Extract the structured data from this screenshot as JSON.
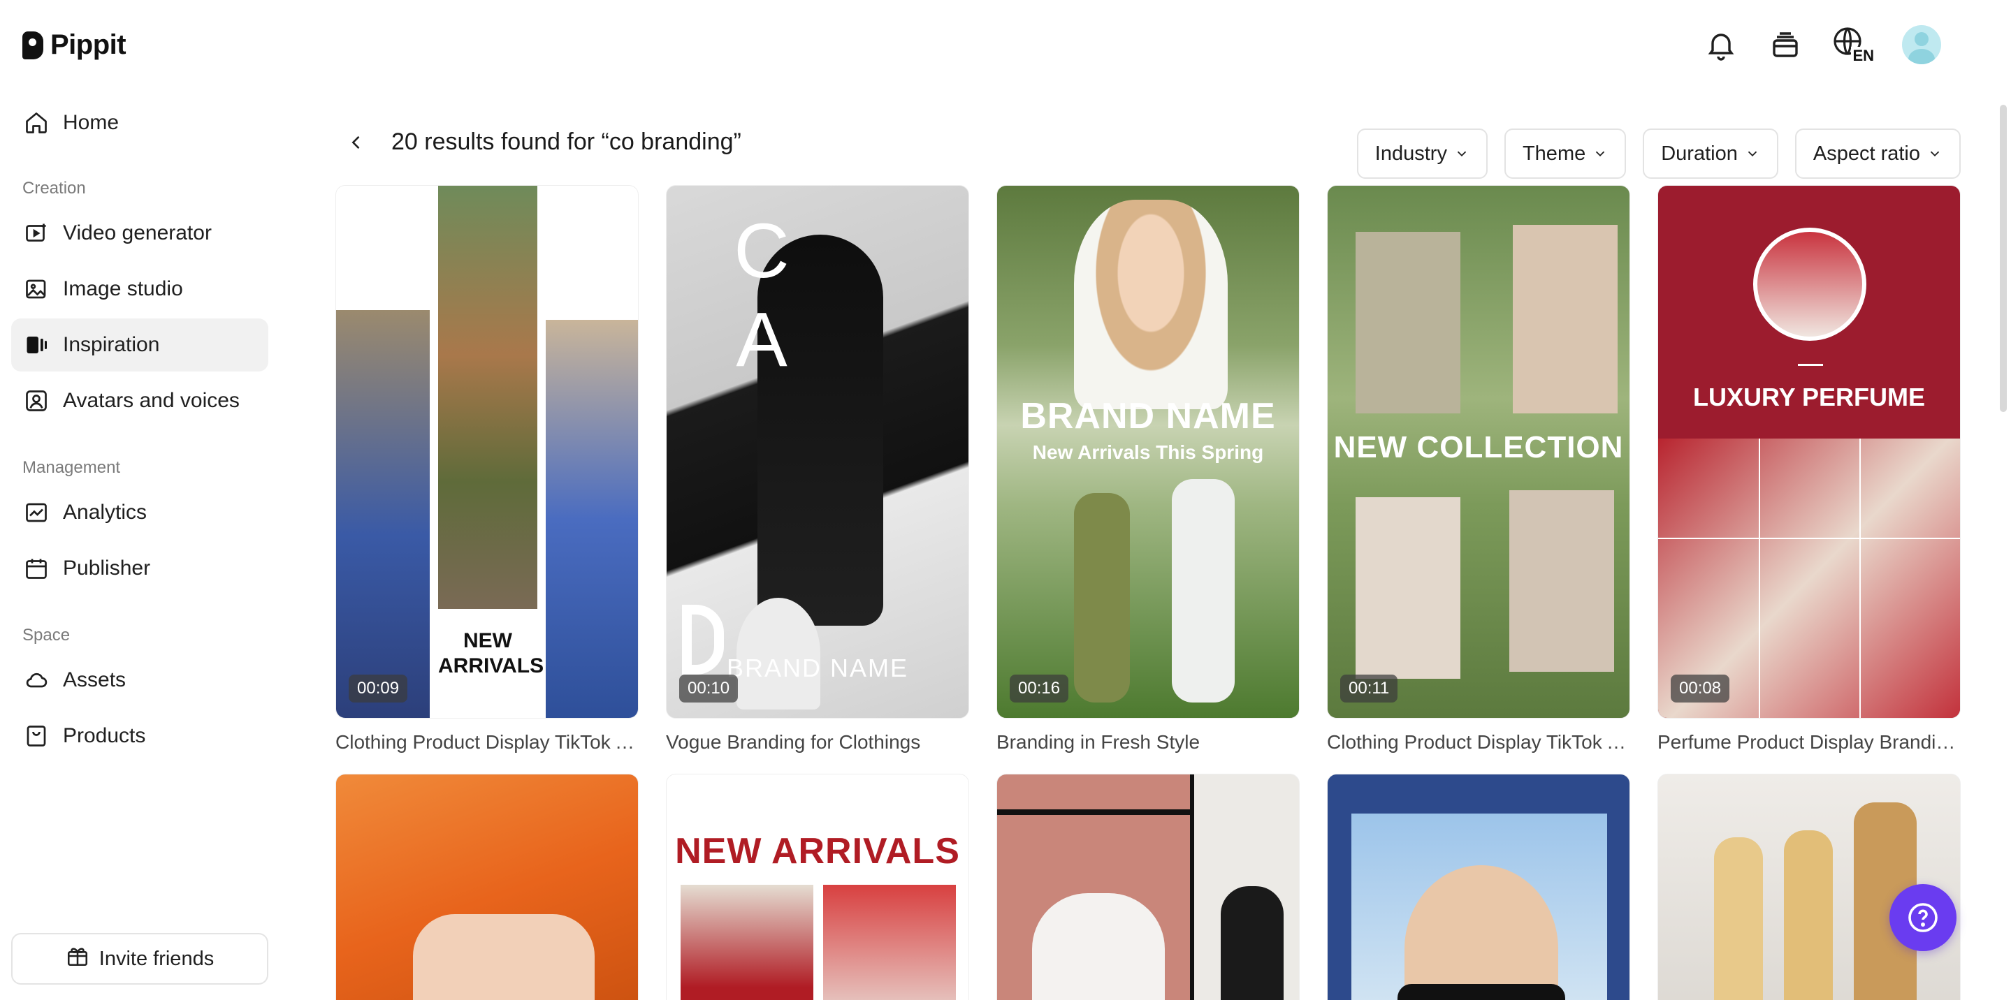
{
  "app": {
    "name": "Pippit"
  },
  "sidebar": {
    "home": "Home",
    "creation_label": "Creation",
    "creation_items": [
      "Video generator",
      "Image studio",
      "Inspiration",
      "Avatars and voices"
    ],
    "management_label": "Management",
    "management_items": [
      "Analytics",
      "Publisher"
    ],
    "space_label": "Space",
    "space_items": [
      "Assets",
      "Products"
    ],
    "invite": "Invite friends",
    "active_item": "Inspiration"
  },
  "topbar": {
    "language": "EN"
  },
  "results": {
    "title": "20 results found for “co branding”"
  },
  "filters": [
    "Industry",
    "Theme",
    "Duration",
    "Aspect ratio"
  ],
  "cards_row1": [
    {
      "duration": "00:09",
      "title": "Clothing Product Display TikTok Ad",
      "overlay": "NEW ARRIVALS"
    },
    {
      "duration": "00:10",
      "title": "Vogue Branding for Clothings",
      "overlay_letters": "C A",
      "overlay": "BRAND NAME"
    },
    {
      "duration": "00:16",
      "title": "Branding in Fresh Style",
      "overlay": "BRAND NAME",
      "overlay_sub": "New Arrivals This Spring"
    },
    {
      "duration": "00:11",
      "title": "Clothing Product Display TikTok Ad",
      "overlay": "NEW COLLECTION"
    },
    {
      "duration": "00:08",
      "title": "Perfume Product Display Branding Ad",
      "overlay": "LUXURY PERFUME"
    }
  ],
  "cards_row2": [
    {
      "overlay": ""
    },
    {
      "overlay": "NEW ARRIVALS"
    },
    {
      "overlay": ""
    },
    {
      "overlay": ""
    },
    {
      "overlay": ""
    }
  ],
  "colors": {
    "accent": "#6a3cf0",
    "active_bg": "#f1f1f1",
    "perfume_red": "#9c1c2e",
    "orange": "#e8641c"
  }
}
